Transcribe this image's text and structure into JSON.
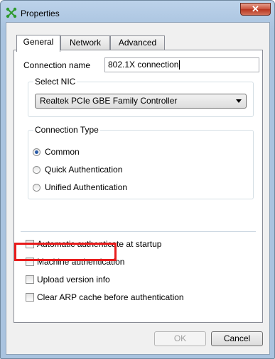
{
  "window": {
    "title": "Properties",
    "close_label": "✕"
  },
  "tabs": [
    {
      "label": "General",
      "active": true
    },
    {
      "label": "Network",
      "active": false
    },
    {
      "label": "Advanced",
      "active": false
    }
  ],
  "general": {
    "connection_name_label": "Connection name",
    "connection_name_value": "802.1X connection",
    "select_nic": {
      "title": "Select NIC",
      "selected": "Realtek PCIe GBE Family Controller"
    },
    "connection_type": {
      "title": "Connection Type",
      "options": [
        {
          "label": "Common",
          "selected": true
        },
        {
          "label": "Quick Authentication",
          "selected": false
        },
        {
          "label": "Unified Authentication",
          "selected": false
        }
      ]
    },
    "checkboxes": [
      {
        "label": "Automatic authenticate at startup",
        "checked": false
      },
      {
        "label": "Machine authentication",
        "checked": false
      },
      {
        "label": "Upload version info",
        "checked": false
      },
      {
        "label": "Clear ARP cache before authentication",
        "checked": false
      }
    ]
  },
  "buttons": {
    "ok": "OK",
    "cancel": "Cancel"
  },
  "colors": {
    "highlight": "#e81c1c",
    "radio_dot": "#2a5ba8"
  }
}
